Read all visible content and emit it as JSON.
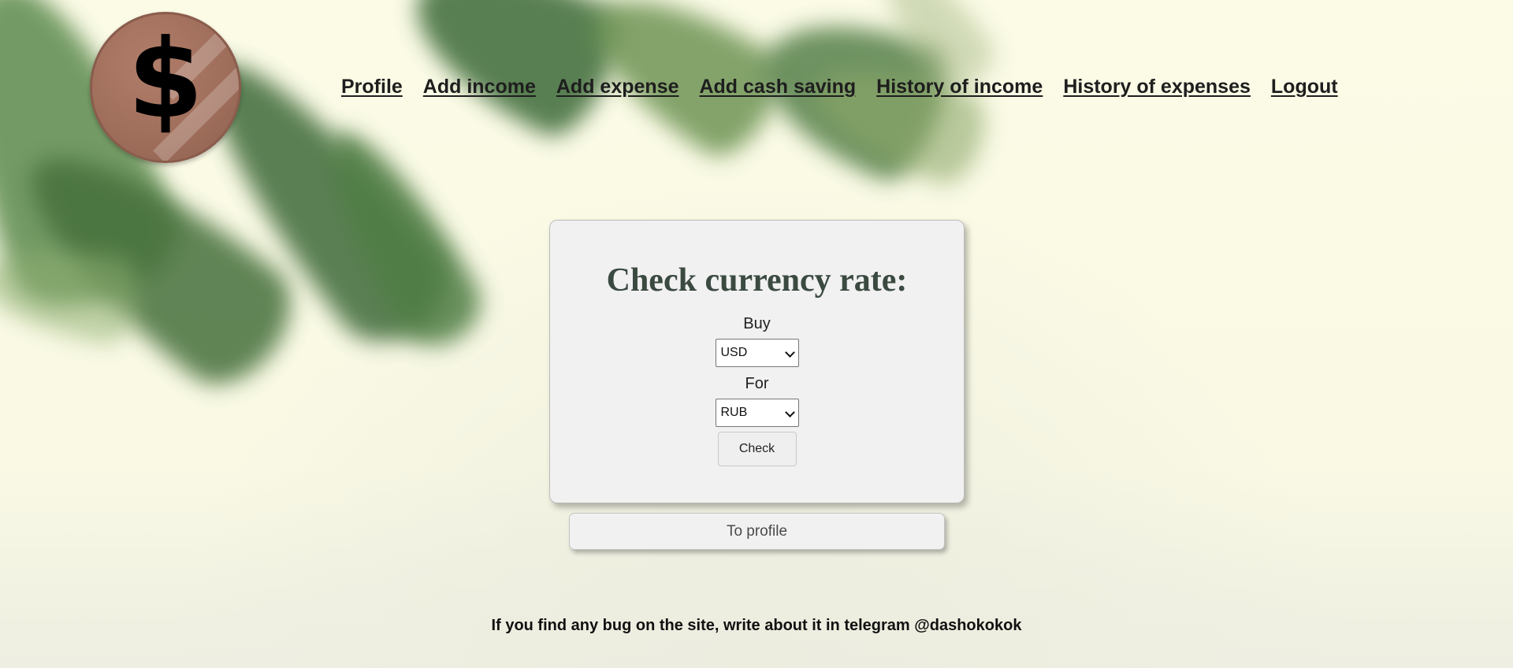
{
  "logo": {
    "glyph": "$"
  },
  "nav": {
    "items": [
      {
        "label": "Profile"
      },
      {
        "label": "Add income"
      },
      {
        "label": "Add expense"
      },
      {
        "label": "Add cash saving"
      },
      {
        "label": "History of income"
      },
      {
        "label": "History of expenses"
      },
      {
        "label": "Logout"
      }
    ]
  },
  "form": {
    "title": "Check currency rate:",
    "buy_label": "Buy",
    "buy_value": "USD",
    "for_label": "For",
    "for_value": "RUB",
    "submit_label": "Check"
  },
  "to_profile_label": "To profile",
  "footer_text": "If you find any bug on the site, write about it in telegram @dashokokok",
  "colors": {
    "title": "#3b4a41",
    "card_bg": "#f1f1f1",
    "page_bg": "#fbfbe8",
    "logo_coin": "#a06f5c"
  },
  "icons": {
    "logo": "dollar-coin-icon",
    "select_arrow": "chevron-down-icon"
  }
}
